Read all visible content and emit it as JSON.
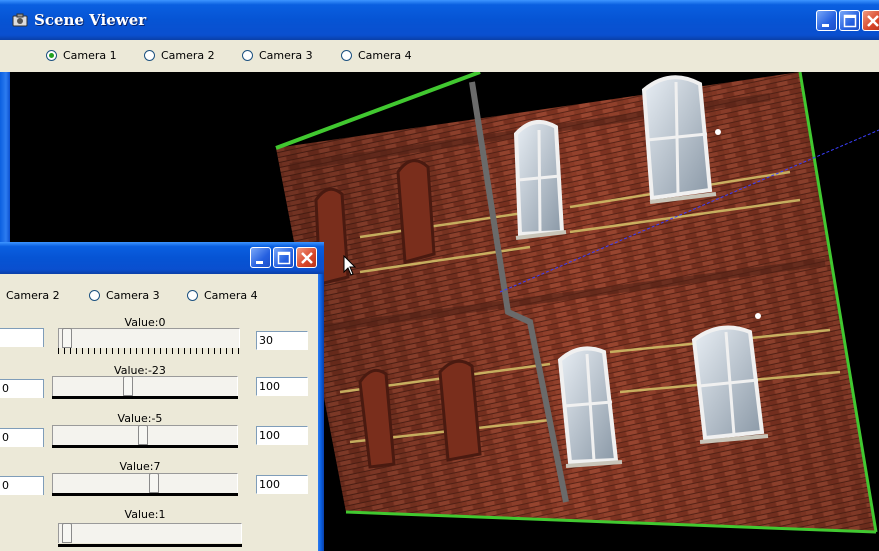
{
  "main_window": {
    "title": "Scene Viewer",
    "radios": [
      {
        "label": "Camera 1",
        "selected": true
      },
      {
        "label": "Camera 2",
        "selected": false
      },
      {
        "label": "Camera 3",
        "selected": false
      },
      {
        "label": "Camera 4",
        "selected": false
      }
    ]
  },
  "sub_window": {
    "title": "",
    "radios": [
      {
        "label": "Camera 2",
        "selected": false
      },
      {
        "label": "Camera 3",
        "selected": false
      },
      {
        "label": "Camera 4",
        "selected": false
      }
    ],
    "sliders": [
      {
        "value_label": "Value:0",
        "left_value": "",
        "right_value": "30",
        "level": 0.02
      },
      {
        "value_label": "Value:-23",
        "left_value": "0",
        "right_value": "100",
        "level": 0.4
      },
      {
        "value_label": "Value:-5",
        "left_value": "0",
        "right_value": "100",
        "level": 0.49
      },
      {
        "value_label": "Value:7",
        "left_value": "0",
        "right_value": "100",
        "level": 0.55
      },
      {
        "value_label": "Value:1",
        "left_value": "",
        "right_value": "",
        "level": 0.02
      }
    ]
  },
  "colors": {
    "titlebar": "#0a5fe0",
    "dialog_bg": "#ece9d8",
    "close_red": "#d8462a",
    "edge_green": "#41c830",
    "brick": "#8a3a26",
    "mortar_stripe": "#d6c46a"
  },
  "viewport": {
    "content": "textured brick facade"
  }
}
